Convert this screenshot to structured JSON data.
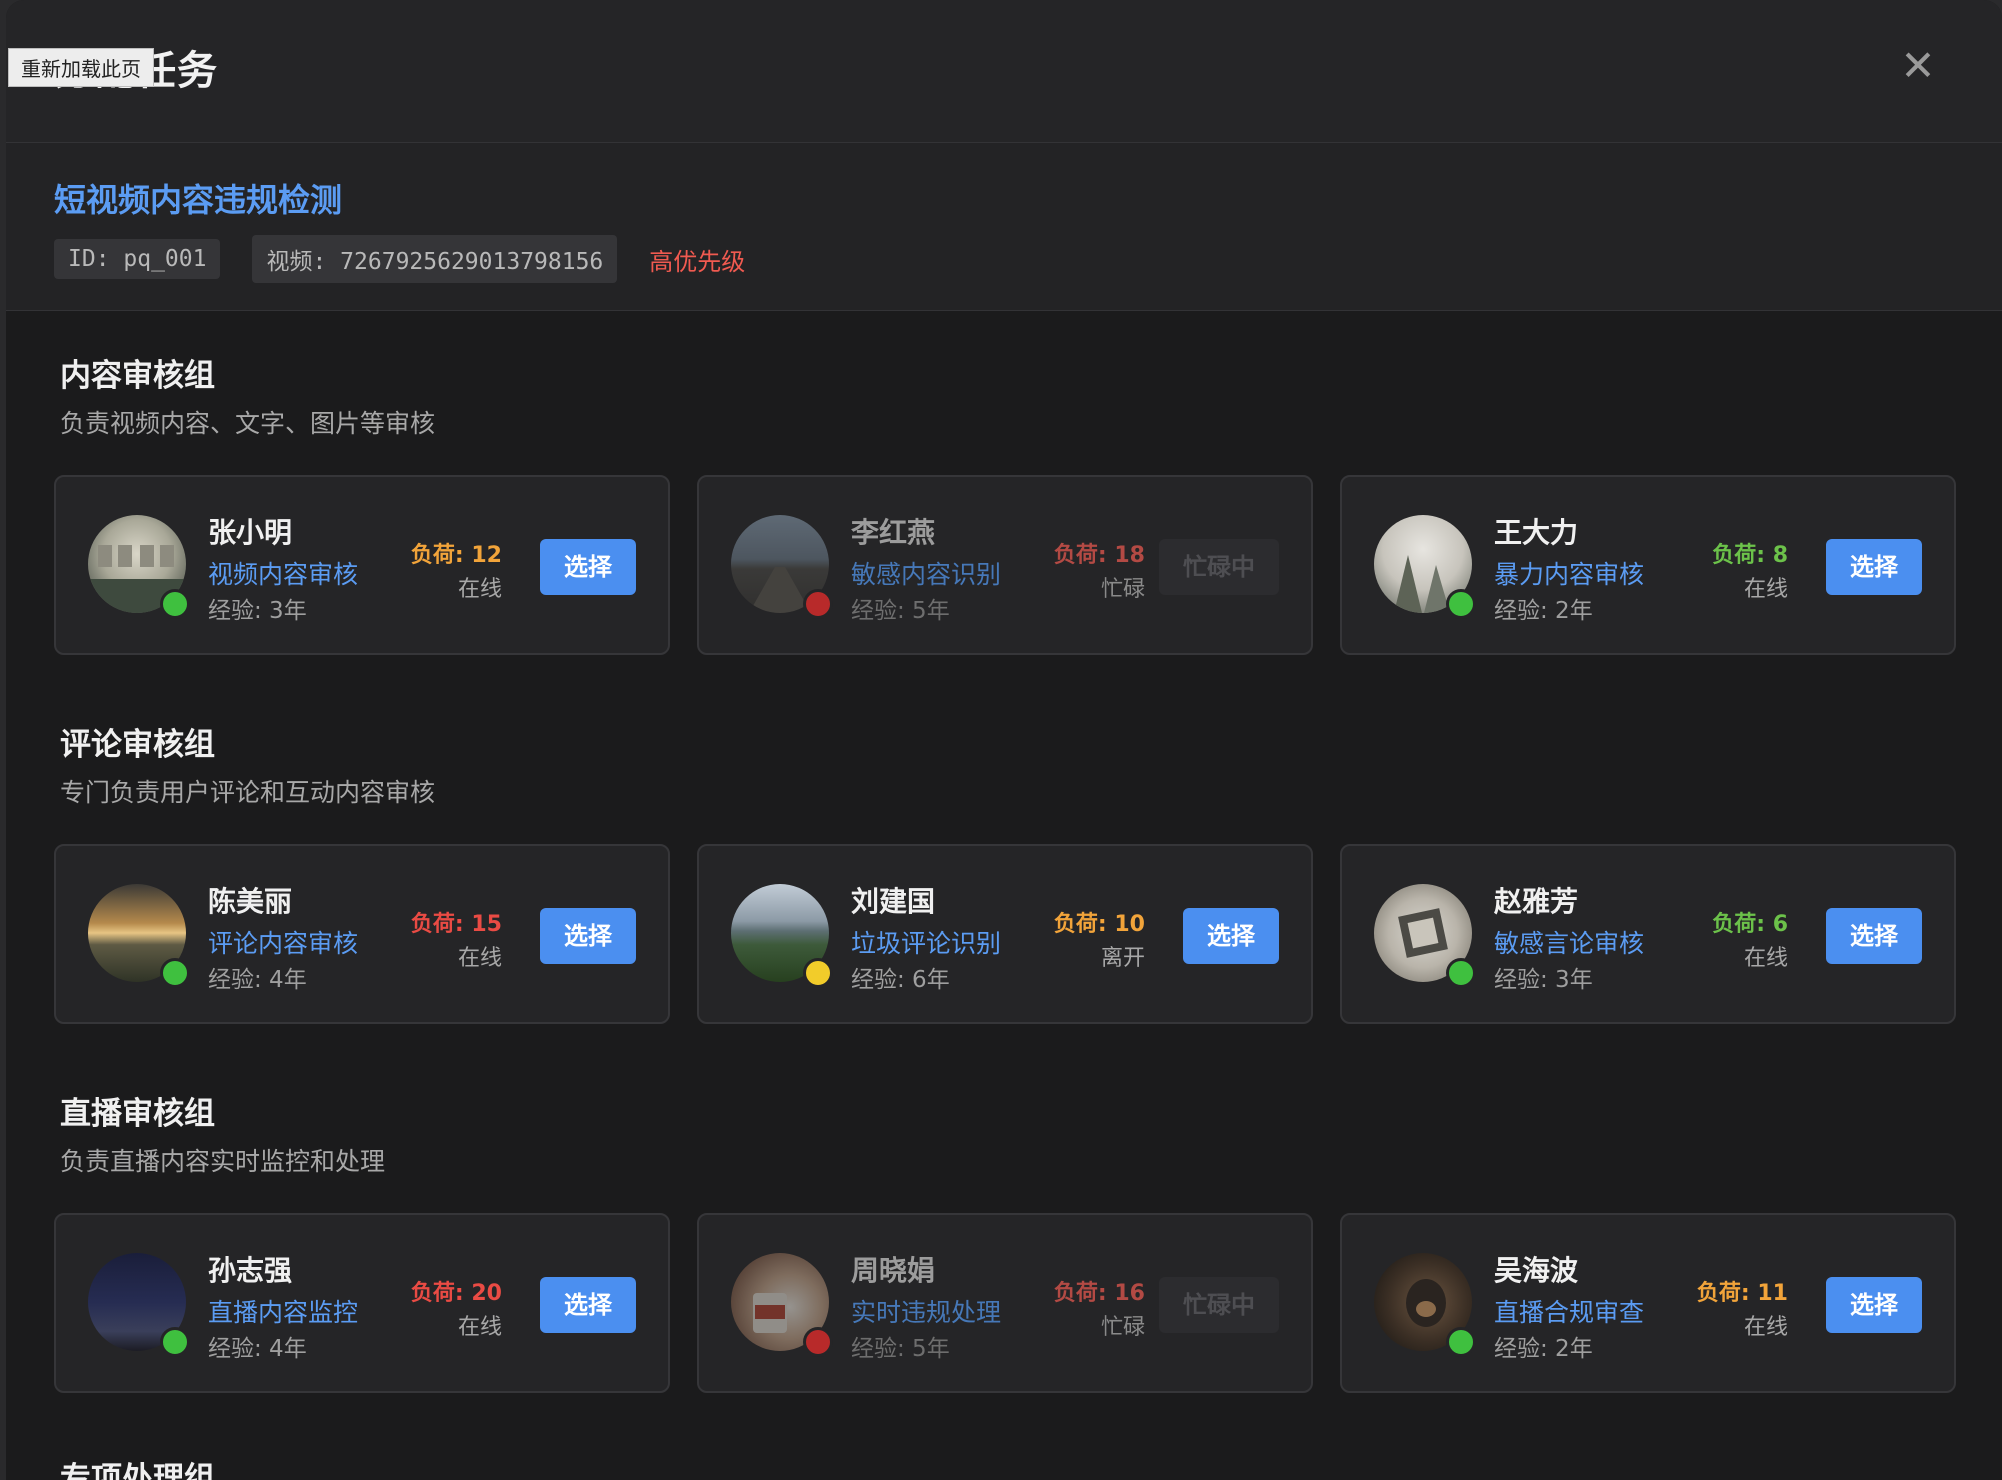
{
  "reload_tooltip": "重新加载此页",
  "modal": {
    "title": "分配任务"
  },
  "task": {
    "title": "短视频内容违规检测",
    "id_chip": "ID: pq_001",
    "video_chip": "视频: 7267925629013798156",
    "priority": "高优先级"
  },
  "groups": [
    {
      "title": "内容审核组",
      "desc": "负责视频内容、文字、图片等审核",
      "members": [
        {
          "name": "张小明",
          "specialty": "视频内容审核",
          "exp": "经验: 3年",
          "load": "负荷: 12",
          "state": "在线",
          "button": "选择"
        },
        {
          "name": "李红燕",
          "specialty": "敏感内容识别",
          "exp": "经验: 5年",
          "load": "负荷: 18",
          "state": "忙碌",
          "button": "忙碌中"
        },
        {
          "name": "王大力",
          "specialty": "暴力内容审核",
          "exp": "经验: 2年",
          "load": "负荷: 8",
          "state": "在线",
          "button": "选择"
        }
      ]
    },
    {
      "title": "评论审核组",
      "desc": "专门负责用户评论和互动内容审核",
      "members": [
        {
          "name": "陈美丽",
          "specialty": "评论内容审核",
          "exp": "经验: 4年",
          "load": "负荷: 15",
          "state": "在线",
          "button": "选择"
        },
        {
          "name": "刘建国",
          "specialty": "垃圾评论识别",
          "exp": "经验: 6年",
          "load": "负荷: 10",
          "state": "离开",
          "button": "选择"
        },
        {
          "name": "赵雅芳",
          "specialty": "敏感言论审核",
          "exp": "经验: 3年",
          "load": "负荷: 6",
          "state": "在线",
          "button": "选择"
        }
      ]
    },
    {
      "title": "直播审核组",
      "desc": "负责直播内容实时监控和处理",
      "members": [
        {
          "name": "孙志强",
          "specialty": "直播内容监控",
          "exp": "经验: 4年",
          "load": "负荷: 20",
          "state": "在线",
          "button": "选择"
        },
        {
          "name": "周晓娟",
          "specialty": "实时违规处理",
          "exp": "经验: 5年",
          "load": "负荷: 16",
          "state": "忙碌",
          "button": "忙碌中"
        },
        {
          "name": "吴海波",
          "specialty": "直播合规审查",
          "exp": "经验: 2年",
          "load": "负荷: 11",
          "state": "在线",
          "button": "选择"
        }
      ]
    }
  ],
  "next_group_title": "专项处理组",
  "colors": {
    "accent": "#4b8ff0",
    "online": "#3fc03f",
    "busy": "#b82a2a",
    "away": "#f2cc2a",
    "load_low": "#6cc24a",
    "load_mid": "#f2a43a",
    "load_high": "#ea4b44"
  }
}
